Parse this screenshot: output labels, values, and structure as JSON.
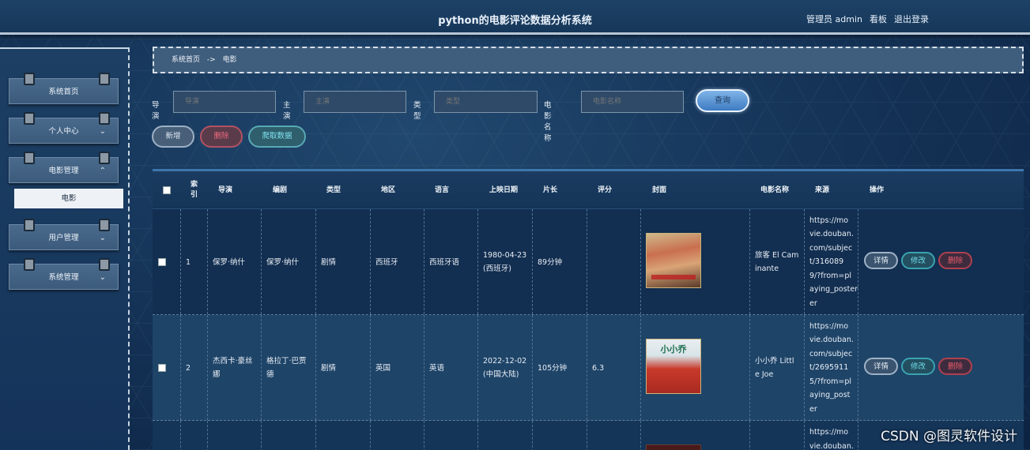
{
  "header": {
    "title": "python的电影评论数据分析系统",
    "user": "管理员 admin",
    "board": "看板",
    "logout": "退出登录"
  },
  "sidebar": {
    "items": [
      {
        "label": "系统首页",
        "chevron": ""
      },
      {
        "label": "个人中心",
        "chevron": "⌄"
      },
      {
        "label": "电影管理",
        "chevron": "⌃"
      },
      {
        "label": "用户管理",
        "chevron": "⌄"
      },
      {
        "label": "系统管理",
        "chevron": "⌄"
      }
    ],
    "sub_active": "电影"
  },
  "breadcrumb": {
    "home": "系统首页",
    "sep": "->",
    "current": "电影"
  },
  "search": {
    "director_label": "导演",
    "director_placeholder": "导演",
    "star_label": "主演",
    "star_placeholder": "主演",
    "genre_label": "类型",
    "genre_placeholder": "类型",
    "name_label": "电影名称",
    "name_placeholder": "电影名称",
    "query_button": "查询"
  },
  "toolbar": {
    "add": "新增",
    "delete": "删除",
    "crawl": "爬取数据"
  },
  "table": {
    "headers": {
      "index": "索\n引",
      "director": "导演",
      "writer": "编剧",
      "genre": "类型",
      "region": "地区",
      "language": "语言",
      "release": "上映日期",
      "length": "片长",
      "rating": "评分",
      "cover": "封面",
      "name": "电影名称",
      "source": "来源",
      "actions": "操作"
    },
    "rows": [
      {
        "index": "1",
        "director": "保罗·纳什",
        "writer": "保罗·纳什",
        "genre": "剧情",
        "region": "西班牙",
        "language": "西班牙语",
        "release": "1980-04-23\n(西班牙)",
        "length": "89分钟",
        "rating": "",
        "name": "旅客 El Cam\ninante",
        "source": "https://mo\nvie.douban.\ncom/subjec\nt/316089\n9/?from=pl\naying_poster\ner"
      },
      {
        "index": "2",
        "director": "杰西卡·豪丝\n娜",
        "writer": "格拉丁·巴贾\n德",
        "genre": "剧情",
        "region": "英国",
        "language": "英语",
        "release": "2022-12-02\n(中国大陆)",
        "length": "105分钟",
        "rating": "6.3",
        "name": "小小乔 Littl\ne Joe",
        "source": "https://mo\nvie.douban.\ncom/subjec\nt/2695911\n5/?from=pl\naying_post\ner"
      },
      {
        "source": "https://mo\nvie.douban."
      }
    ],
    "actions": {
      "detail": "详情",
      "edit": "修改",
      "delete": "删除"
    }
  },
  "poster2_title": "小小乔",
  "watermark": "CSDN @图灵软件设计",
  "colors": {
    "accent": "#3d7bc2",
    "delete": "#e0455a",
    "edit": "#2aa5b5"
  }
}
